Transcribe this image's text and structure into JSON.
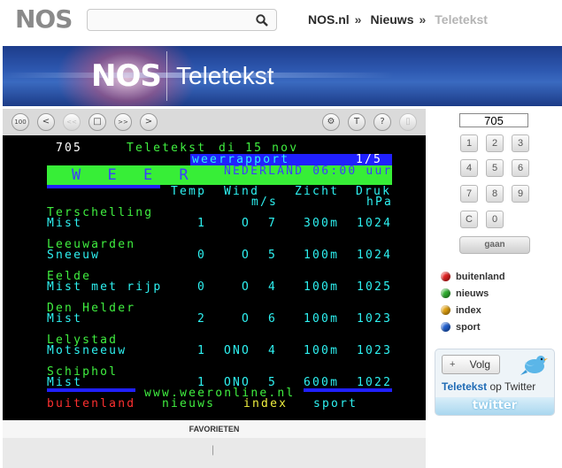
{
  "header": {
    "logo": "NOS",
    "search": {
      "value": "",
      "placeholder": ""
    },
    "breadcrumb": [
      {
        "label": "NOS.nl",
        "sep": "»"
      },
      {
        "label": "Nieuws",
        "sep": "»"
      },
      {
        "label": "Teletekst",
        "sep": ""
      }
    ]
  },
  "banner": {
    "logo": "NOS",
    "title": "Teletekst"
  },
  "toolbar": {
    "buttons": [
      {
        "name": "page-100-button",
        "label": "100"
      },
      {
        "name": "prev-page-button",
        "label": "<"
      },
      {
        "name": "prev-subpage-button",
        "label": "<<"
      },
      {
        "name": "pause-button",
        "label": "□"
      },
      {
        "name": "next-subpage-button",
        "label": ">>"
      },
      {
        "name": "next-page-button",
        "label": ">"
      },
      {
        "name": "settings-button",
        "label": "⚙"
      },
      {
        "name": "text-button",
        "label": "T"
      },
      {
        "name": "help-button",
        "label": "?"
      },
      {
        "name": "mobile-button",
        "label": "▯"
      }
    ]
  },
  "teletext": {
    "header": {
      "page": "705",
      "service": "Teletekst",
      "date": "di 15 nov"
    },
    "section_tag": "weerrapport",
    "subpage": "1/5",
    "title": "W E E R",
    "subtitle": "NEDERLAND 06:00 uur",
    "columns": {
      "temp": "Temp",
      "wind": "Wind",
      "wind_unit": "m/s",
      "sight": "Zicht",
      "pressure": "Druk",
      "pressure_unit": "hPa"
    },
    "stations": [
      {
        "place": "Terschelling",
        "weather": "Mist",
        "temp": "1",
        "dir": "O",
        "speed": "7",
        "sight": "300m",
        "pressure": "1024"
      },
      {
        "place": "Leeuwarden",
        "weather": "Sneeuw",
        "temp": "0",
        "dir": "O",
        "speed": "5",
        "sight": "100m",
        "pressure": "1024"
      },
      {
        "place": "Eelde",
        "weather": "Mist met rijp",
        "temp": "0",
        "dir": "O",
        "speed": "4",
        "sight": "100m",
        "pressure": "1025"
      },
      {
        "place": "Den Helder",
        "weather": "Mist",
        "temp": "2",
        "dir": "O",
        "speed": "6",
        "sight": "100m",
        "pressure": "1023"
      },
      {
        "place": "Lelystad",
        "weather": "Motsneeuw",
        "temp": "1",
        "dir": "ONO",
        "speed": "4",
        "sight": "100m",
        "pressure": "1023"
      },
      {
        "place": "Schiphol",
        "weather": "Mist",
        "temp": "1",
        "dir": "ONO",
        "speed": "5",
        "sight": "600m",
        "pressure": "1022"
      }
    ],
    "footer_url": "www.weeronline.nl",
    "fastext": [
      {
        "label": "buitenland",
        "color": "#ff3030"
      },
      {
        "label": "nieuws",
        "color": "#40f040"
      },
      {
        "label": "index",
        "color": "#f0f040"
      },
      {
        "label": "sport",
        "color": "#2ef2f2"
      }
    ]
  },
  "favorites": {
    "label": "FAVORIETEN",
    "marker": "|"
  },
  "sidebar": {
    "page_input": "705",
    "keys": [
      "1",
      "2",
      "3",
      "4",
      "5",
      "6",
      "7",
      "8",
      "9",
      "C",
      "0"
    ],
    "go_label": "gaan",
    "color_links": [
      {
        "label": "buitenland",
        "color": "#e02020"
      },
      {
        "label": "nieuws",
        "color": "#30b030"
      },
      {
        "label": "index",
        "color": "#e0a010"
      },
      {
        "label": "sport",
        "color": "#2060d0"
      }
    ],
    "twitter": {
      "plus": "+",
      "follow_label": "Volg",
      "line_brand": "Teletekst",
      "line_rest": " op Twitter",
      "logo_text": "twitter"
    }
  }
}
